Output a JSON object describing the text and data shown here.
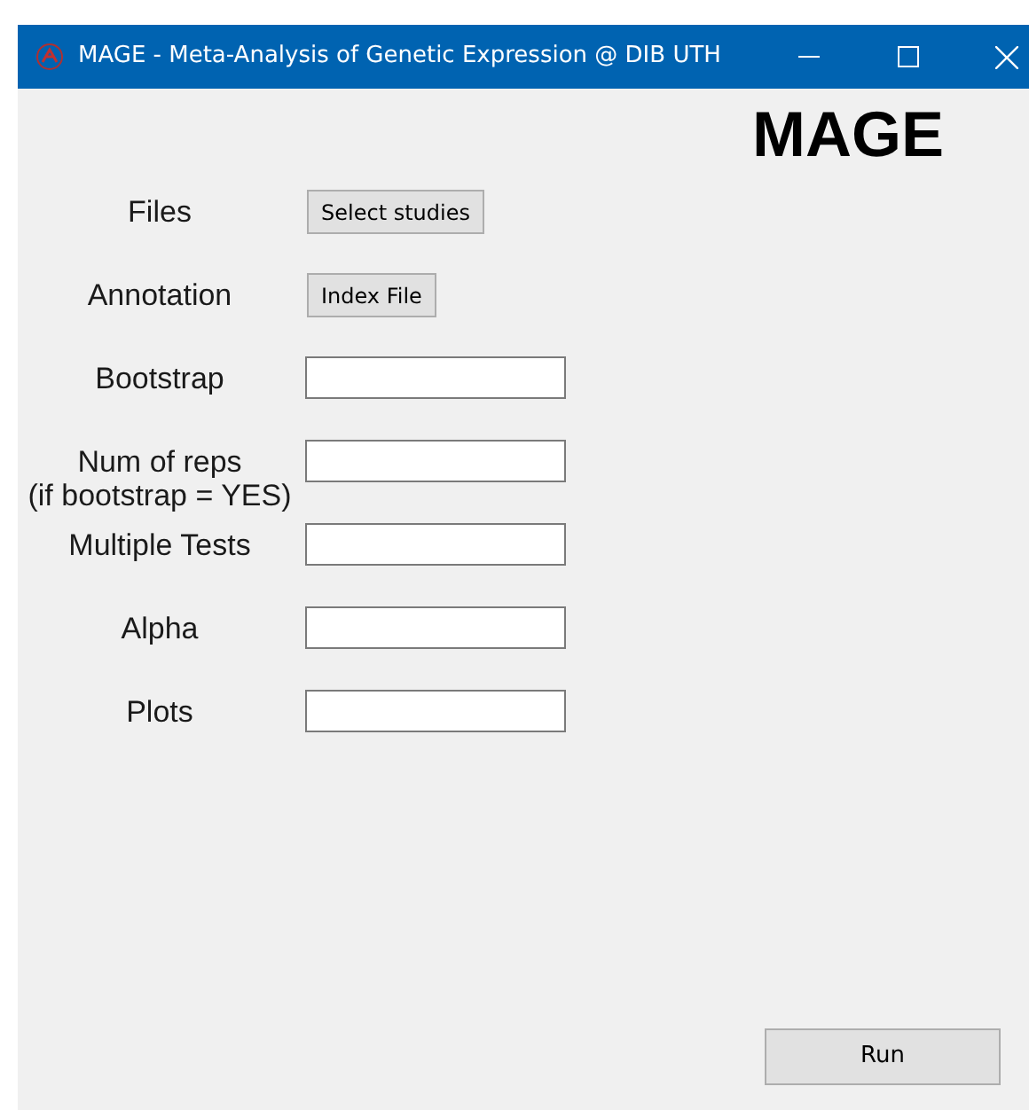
{
  "window": {
    "title": "MAGE - Meta-Analysis of Genetic Expression @ DIB UTH"
  },
  "heading": "MAGE",
  "rows": [
    {
      "label": "Files",
      "kind": "button",
      "button": "Select studies"
    },
    {
      "label": "Annotation",
      "kind": "button",
      "button": "Index File"
    },
    {
      "label": "Bootstrap",
      "kind": "input"
    },
    {
      "label": "Num of reps\n(if bootstrap = YES)",
      "kind": "input"
    },
    {
      "label": "Multiple Tests",
      "kind": "input"
    },
    {
      "label": "Alpha",
      "kind": "input"
    },
    {
      "label": "Plots",
      "kind": "input"
    }
  ],
  "run_button": "Run"
}
